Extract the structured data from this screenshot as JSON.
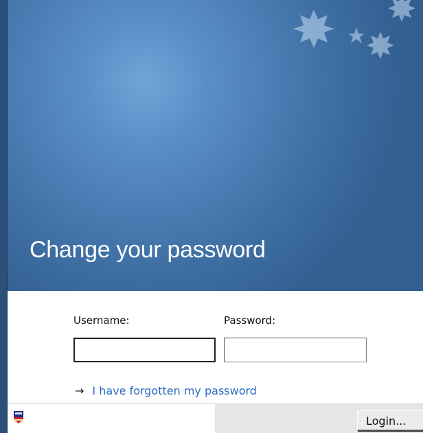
{
  "banner": {
    "title": "Change your password"
  },
  "form": {
    "username_label": "Username:",
    "password_label": "Password:",
    "username_value": "",
    "password_value": "",
    "forgot_arrow": "→",
    "forgot_link": "I have forgotten my password"
  },
  "statusbar": {
    "login_button": "Login..."
  },
  "colors": {
    "banner_blue": "#3c6ca0",
    "link_blue": "#2a6cc0",
    "desktop": "#2b4f78"
  },
  "icons": [
    "stars-decoration",
    "crest-icon"
  ]
}
